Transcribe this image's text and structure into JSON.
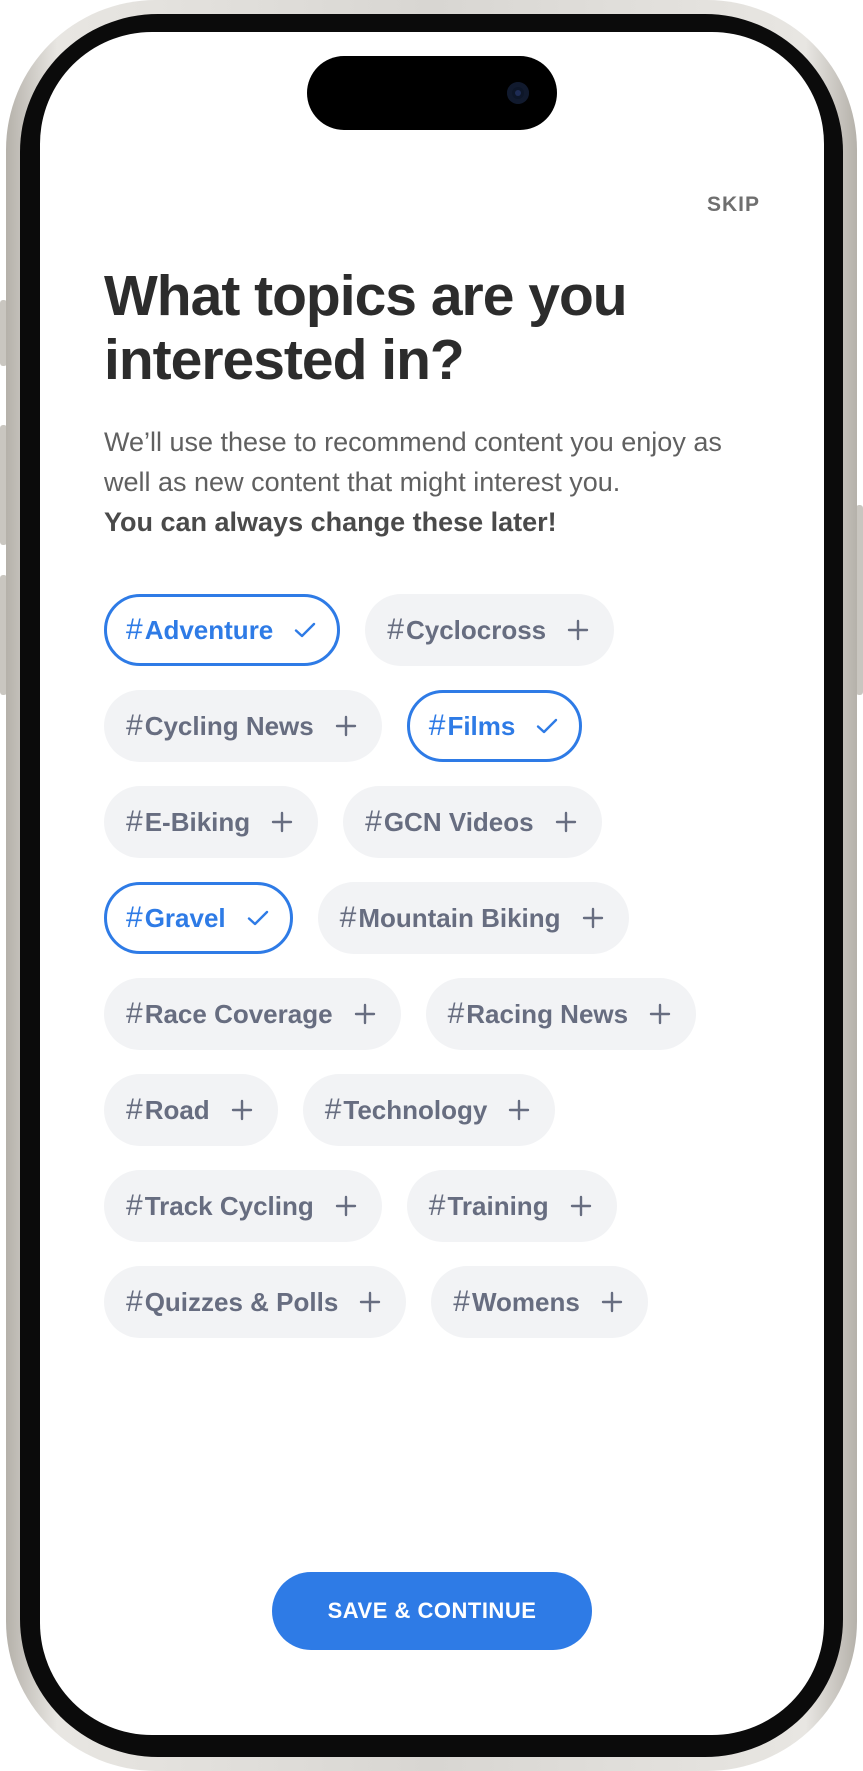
{
  "header": {
    "skip_label": "SKIP"
  },
  "main": {
    "title": "What topics are you interested in?",
    "subtitle": "We’ll use these to recommend content you enjoy as well as new content that might interest you.",
    "subtitle_emphasis": "You can always change these later!"
  },
  "topics": [
    {
      "label": "Adventure",
      "selected": true
    },
    {
      "label": "Cyclocross",
      "selected": false
    },
    {
      "label": "Cycling News",
      "selected": false
    },
    {
      "label": "Films",
      "selected": true
    },
    {
      "label": "E-Biking",
      "selected": false
    },
    {
      "label": "GCN Videos",
      "selected": false
    },
    {
      "label": "Gravel",
      "selected": true
    },
    {
      "label": "Mountain Biking",
      "selected": false
    },
    {
      "label": "Race Coverage",
      "selected": false
    },
    {
      "label": "Racing News",
      "selected": false
    },
    {
      "label": "Road",
      "selected": false
    },
    {
      "label": "Technology",
      "selected": false
    },
    {
      "label": "Track Cycling",
      "selected": false
    },
    {
      "label": "Training",
      "selected": false
    },
    {
      "label": "Quizzes & Polls",
      "selected": false
    },
    {
      "label": "Womens",
      "selected": false
    }
  ],
  "hash_symbol": "#",
  "footer": {
    "cta_label": "SAVE & CONTINUE"
  },
  "colors": {
    "accent": "#2e7be6",
    "chip_bg": "#f2f3f5",
    "chip_text": "#676d80",
    "title_text": "#2c2c2c"
  },
  "icons": {
    "selected": "check-icon",
    "unselected": "plus-icon"
  }
}
